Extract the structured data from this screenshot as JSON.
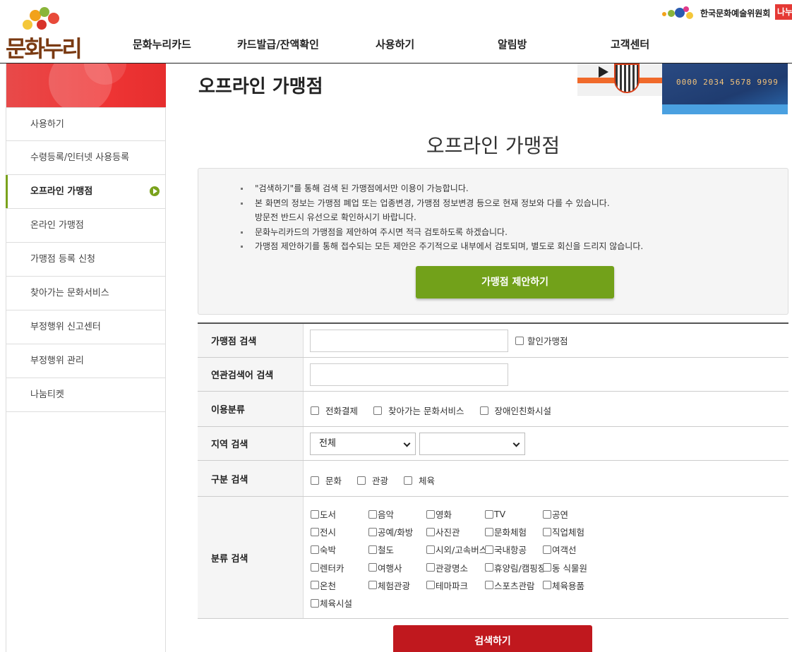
{
  "header": {
    "logo_text": "문화누리",
    "nav": [
      "문화누리카드",
      "카드발급/잔액확인",
      "사용하기",
      "알림방",
      "고객센터"
    ],
    "org_name": "한국문화예술위원회",
    "badge_text": "나누",
    "colors": {
      "logo": "#7a3a12",
      "badge": "#e53935"
    }
  },
  "sidebar": {
    "items": [
      {
        "label": "사용하기",
        "active": false
      },
      {
        "label": "수령등록/인터넷 사용등록",
        "active": false
      },
      {
        "label": "오프라인 가맹점",
        "active": true
      },
      {
        "label": "온라인 가맹점",
        "active": false
      },
      {
        "label": "가맹점 등록 신청",
        "active": false
      },
      {
        "label": "찾아가는 문화서비스",
        "active": false
      },
      {
        "label": "부정행위 신고센터",
        "active": false
      },
      {
        "label": "부정행위 관리",
        "active": false
      },
      {
        "label": "나눔티켓",
        "active": false
      }
    ],
    "active_color": "#7aa21c",
    "banner_color": "#ef3535"
  },
  "page": {
    "title": "오프라인 가맹점",
    "section_title": "오프라인 가맹점",
    "card_number": "0000 2034 5678 9999"
  },
  "notice": {
    "lines": [
      {
        "text": "\"검색하기\"를 통해 검색 된 가맹점에서만 이용이 가능합니다.",
        "bullet": true
      },
      {
        "text": "본 화면의 정보는 가맹점 폐업 또는 업종변경, 가맹점 정보변경 등으로 현재 정보와 다를 수 있습니다.",
        "bullet": true
      },
      {
        "text": "방문전 반드시 유선으로 확인하시기 바랍니다.",
        "bullet": false
      },
      {
        "text": "문화누리카드의 가맹점을 제안하여 주시면 적극 검토하도록 하겠습니다.",
        "bullet": true
      },
      {
        "text": "가맹점 제안하기를 통해 접수되는 모든 제안은 주기적으로 내부에서 검토되며, 별도로 회신을 드리지 않습니다.",
        "bullet": true
      }
    ],
    "suggest_button": "가맹점 제안하기",
    "suggest_color": "#72a11a"
  },
  "search": {
    "store_label": "가맹점 검색",
    "store_value": "",
    "discount_label": "할인가맹점",
    "related_label": "연관검색어 검색",
    "related_value": "",
    "usage_label": "이용분류",
    "usage_options": [
      "전화결제",
      "찾아가는 문화서비스",
      "장애인친화시설"
    ],
    "region_label": "지역 검색",
    "region_selected": "전체",
    "region_sub_selected": "",
    "type_label": "구분 검색",
    "type_options": [
      "문화",
      "관광",
      "체육"
    ],
    "category_label": "분류 검색",
    "categories": [
      [
        "도서",
        "음악",
        "영화",
        "TV",
        "공연"
      ],
      [
        "전시",
        "공예/화방",
        "사진관",
        "문화체험",
        "직업체험"
      ],
      [
        "숙박",
        "철도",
        "시외/고속버스",
        "국내항공",
        "여객선"
      ],
      [
        "렌터카",
        "여행사",
        "관광명소",
        "휴양림/캠핑장",
        "동 식물원"
      ],
      [
        "온천",
        "체험관광",
        "테마파크",
        "스포츠관람",
        "체육용품"
      ],
      [
        "체육시설"
      ]
    ],
    "search_button": "검색하기",
    "search_color": "#c0181e"
  }
}
